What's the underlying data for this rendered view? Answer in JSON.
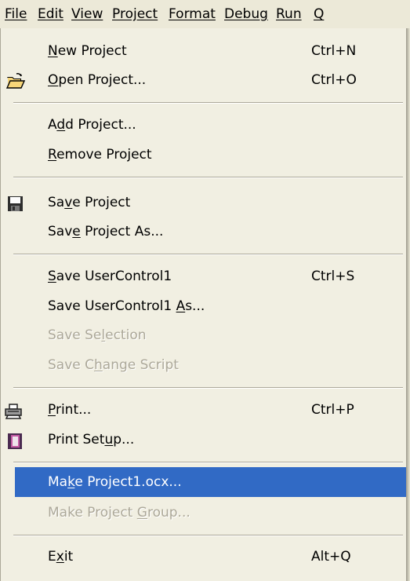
{
  "menubar": {
    "items": [
      "File",
      "Edit",
      "View",
      "Project",
      "Format",
      "Debug",
      "Run",
      "Q"
    ]
  },
  "menu": {
    "new_project": {
      "pre": "",
      "key": "N",
      "post": "ew Project",
      "shortcut": "Ctrl+N"
    },
    "open_project": {
      "pre": "",
      "key": "O",
      "post": "pen Project...",
      "shortcut": "Ctrl+O",
      "icon": "open-folder-icon"
    },
    "add_project": {
      "pre": "A",
      "key": "d",
      "post": "d Project..."
    },
    "remove_project": {
      "pre": "",
      "key": "R",
      "post": "emove Project"
    },
    "save_project": {
      "pre": "Sa",
      "key": "v",
      "post": "e Project",
      "icon": "floppy-disk-icon"
    },
    "save_project_as": {
      "pre": "Sav",
      "key": "e",
      "post": " Project As..."
    },
    "save_usercontrol": {
      "pre": "",
      "key": "S",
      "post": "ave UserControl1",
      "shortcut": "Ctrl+S"
    },
    "save_usercontrol_as": {
      "pre": "Save UserControl1 ",
      "key": "A",
      "post": "s..."
    },
    "save_selection": {
      "pre": "Save Se",
      "key": "l",
      "post": "ection"
    },
    "save_change_script": {
      "pre": "Save C",
      "key": "h",
      "post": "ange Script"
    },
    "print": {
      "pre": "",
      "key": "P",
      "post": "rint...",
      "shortcut": "Ctrl+P",
      "icon": "printer-icon"
    },
    "print_setup": {
      "pre": "Print Set",
      "key": "u",
      "post": "p...",
      "icon": "print-setup-icon"
    },
    "make_ocx": {
      "pre": "Ma",
      "key": "k",
      "post": "e Project1.ocx..."
    },
    "make_group": {
      "pre": "Make Project ",
      "key": "G",
      "post": "roup..."
    },
    "exit": {
      "pre": "E",
      "key": "x",
      "post": "it",
      "shortcut": "Alt+Q"
    }
  },
  "colors": {
    "highlight": "#316ac5",
    "menu_bg": "#f1efe2",
    "disabled_text": "#aca899"
  }
}
